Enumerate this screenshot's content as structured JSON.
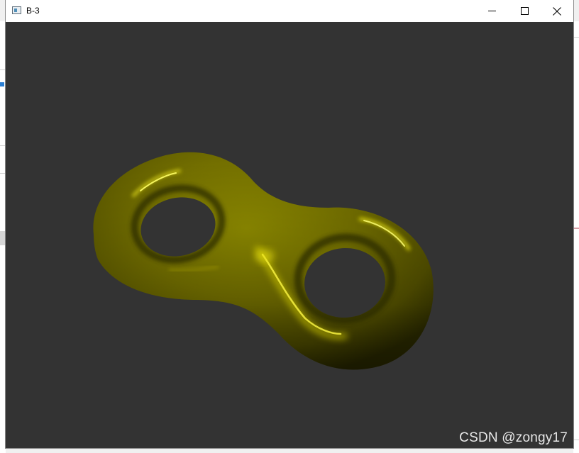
{
  "window": {
    "title": "B-3",
    "controls": {
      "minimize_icon": "minimize-icon",
      "maximize_icon": "maximize-icon",
      "close_icon": "close-icon"
    }
  },
  "viewport": {
    "background_color": "#333333",
    "object": "double-torus",
    "object_color": "#8a8a00"
  },
  "watermark": "CSDN @zongy17"
}
